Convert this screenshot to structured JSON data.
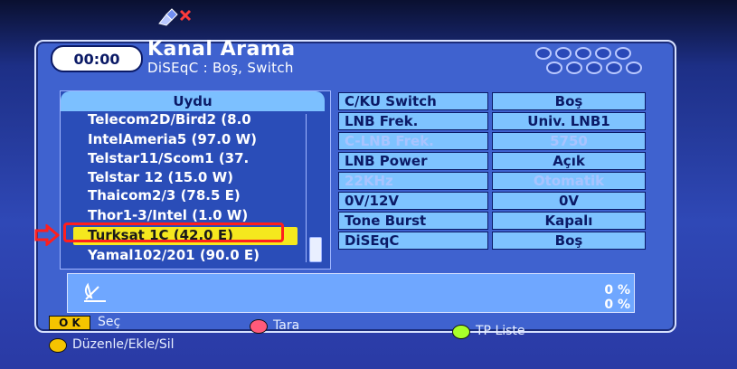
{
  "header": {
    "time": "00:00",
    "title": "Kanal Arama",
    "subtitle": "DiSEqC : Boş, Switch"
  },
  "satellite_list": {
    "header": "Uydu",
    "items": [
      {
        "label": "Telecom2D/Bird2 (8.0"
      },
      {
        "label": "IntelAmeria5 (97.0 W)"
      },
      {
        "label": "Telstar11/Scom1 (37."
      },
      {
        "label": "Telstar 12 (15.0 W)"
      },
      {
        "label": "Thaicom2/3 (78.5 E)"
      },
      {
        "label": "Thor1-3/Intel  (1.0 W)"
      },
      {
        "label": "Turksat 1C (42.0 E)",
        "selected": true
      },
      {
        "label": "Yamal102/201 (90.0 E)"
      }
    ]
  },
  "settings": [
    {
      "label": "C/KU Switch",
      "value": "Boş",
      "enabled": true
    },
    {
      "label": "LNB Frek.",
      "value": "Univ. LNB1",
      "enabled": true
    },
    {
      "label": "C-LNB Frek.",
      "value": "5750",
      "enabled": false
    },
    {
      "label": "LNB Power",
      "value": "Açık",
      "enabled": true
    },
    {
      "label": "22KHz",
      "value": "Otomatik",
      "enabled": false
    },
    {
      "label": "0V/12V",
      "value": "0V",
      "enabled": true
    },
    {
      "label": "Tone Burst",
      "value": "Kapalı",
      "enabled": true
    },
    {
      "label": "DiSEqC",
      "value": "Boş",
      "enabled": true
    }
  ],
  "status": {
    "percent_1": "0 %",
    "percent_2": "0 %"
  },
  "legend": {
    "ok_key": "O K",
    "ok_label": "Seç",
    "red_label": "Tara",
    "green_label": "TP Liste",
    "yellow_label": "Düzenle/Ekle/Sil"
  },
  "icons": [
    "satellite-off-icon",
    "dots-pattern-icon",
    "satellite-dish-icon",
    "arrow-icon"
  ],
  "colors": {
    "background": "#2f48b6",
    "panel": "#3f62cf",
    "field": "#7ec3ff",
    "highlight": "#f5e81e",
    "annotation": "#ff1e1e",
    "red_button": "#ff5a7a",
    "green_button": "#a8ff2a",
    "yellow_button": "#f5c400"
  }
}
